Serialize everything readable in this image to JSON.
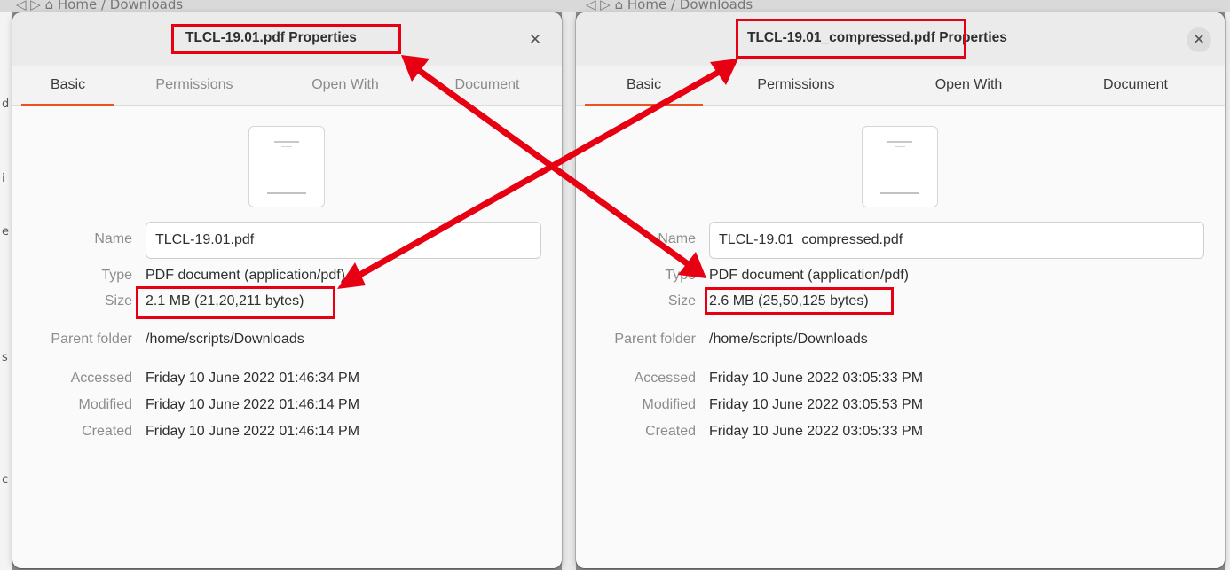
{
  "background": {
    "path_left": "◁  ▷  ⌂ Home  /  Downloads",
    "path_right": "◁  ▷  ⌂ Home  /  Downloads",
    "fragments": [
      "d",
      "i",
      "e",
      "s",
      "c"
    ]
  },
  "left_dialog": {
    "title": "TLCL-19.01.pdf Properties",
    "close_icon": "✕",
    "tabs": [
      "Basic",
      "Permissions",
      "Open With",
      "Document"
    ],
    "active_tab": "Basic",
    "labels": {
      "name": "Name",
      "type": "Type",
      "size": "Size",
      "parent_folder": "Parent folder",
      "accessed": "Accessed",
      "modified": "Modified",
      "created": "Created"
    },
    "values": {
      "name": "TLCL-19.01.pdf",
      "type": "PDF document (application/pdf)",
      "size": "2.1 MB (21,20,211 bytes)",
      "parent_folder": "/home/scripts/Downloads",
      "accessed": "Friday 10 June 2022 01:46:34 PM",
      "modified": "Friday 10 June 2022 01:46:14 PM",
      "created": "Friday 10 June 2022 01:46:14 PM"
    }
  },
  "right_dialog": {
    "title": "TLCL-19.01_compressed.pdf Properties",
    "close_icon": "✕",
    "tabs": [
      "Basic",
      "Permissions",
      "Open With",
      "Document"
    ],
    "active_tab": "Basic",
    "labels": {
      "name": "Name",
      "type": "Type",
      "size": "Size",
      "parent_folder": "Parent folder",
      "accessed": "Accessed",
      "modified": "Modified",
      "created": "Created"
    },
    "values": {
      "name": "TLCL-19.01_compressed.pdf",
      "type": "PDF document (application/pdf)",
      "size": "2.6 MB (25,50,125 bytes)",
      "parent_folder": "/home/scripts/Downloads",
      "accessed": "Friday 10 June 2022 03:05:33 PM",
      "modified": "Friday 10 June 2022 03:05:53 PM",
      "created": "Friday 10 June 2022 03:05:33 PM"
    }
  },
  "colors": {
    "annotation": "#e60012",
    "tab_accent": "#e95420"
  }
}
